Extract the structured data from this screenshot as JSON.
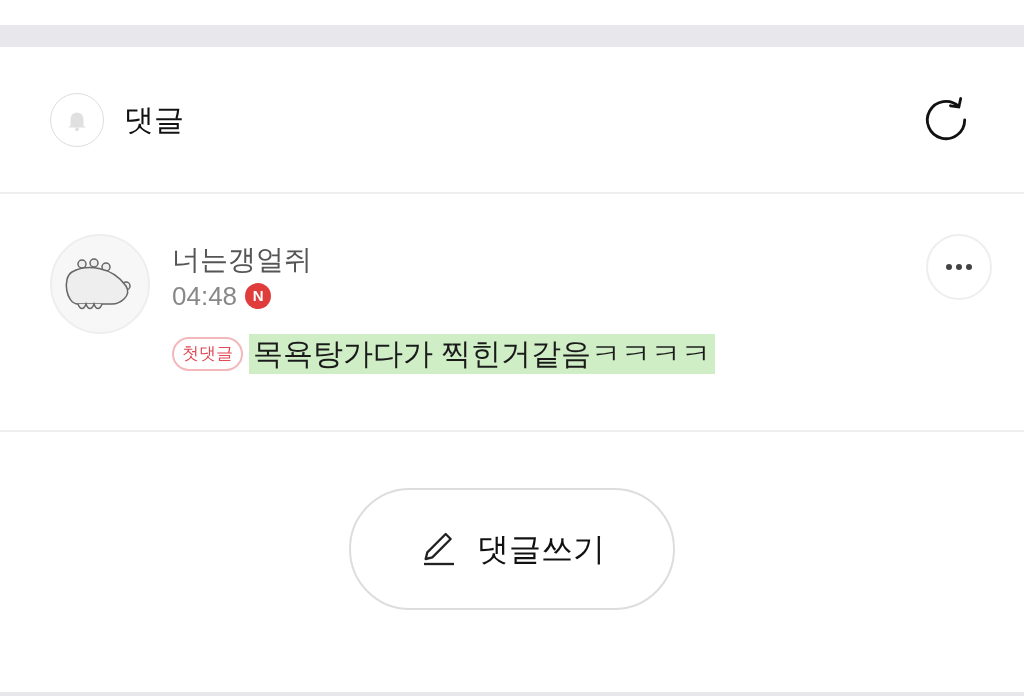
{
  "header": {
    "title": "댓글"
  },
  "comments": [
    {
      "author": "너는갱얼쥐",
      "time": "04:48",
      "new_badge": "N",
      "tag": "첫댓글",
      "text": "목욕탕가다가 찍힌거같음ㅋㅋㅋㅋ",
      "highlighted": true
    }
  ],
  "write_button": {
    "label": "댓글쓰기"
  }
}
